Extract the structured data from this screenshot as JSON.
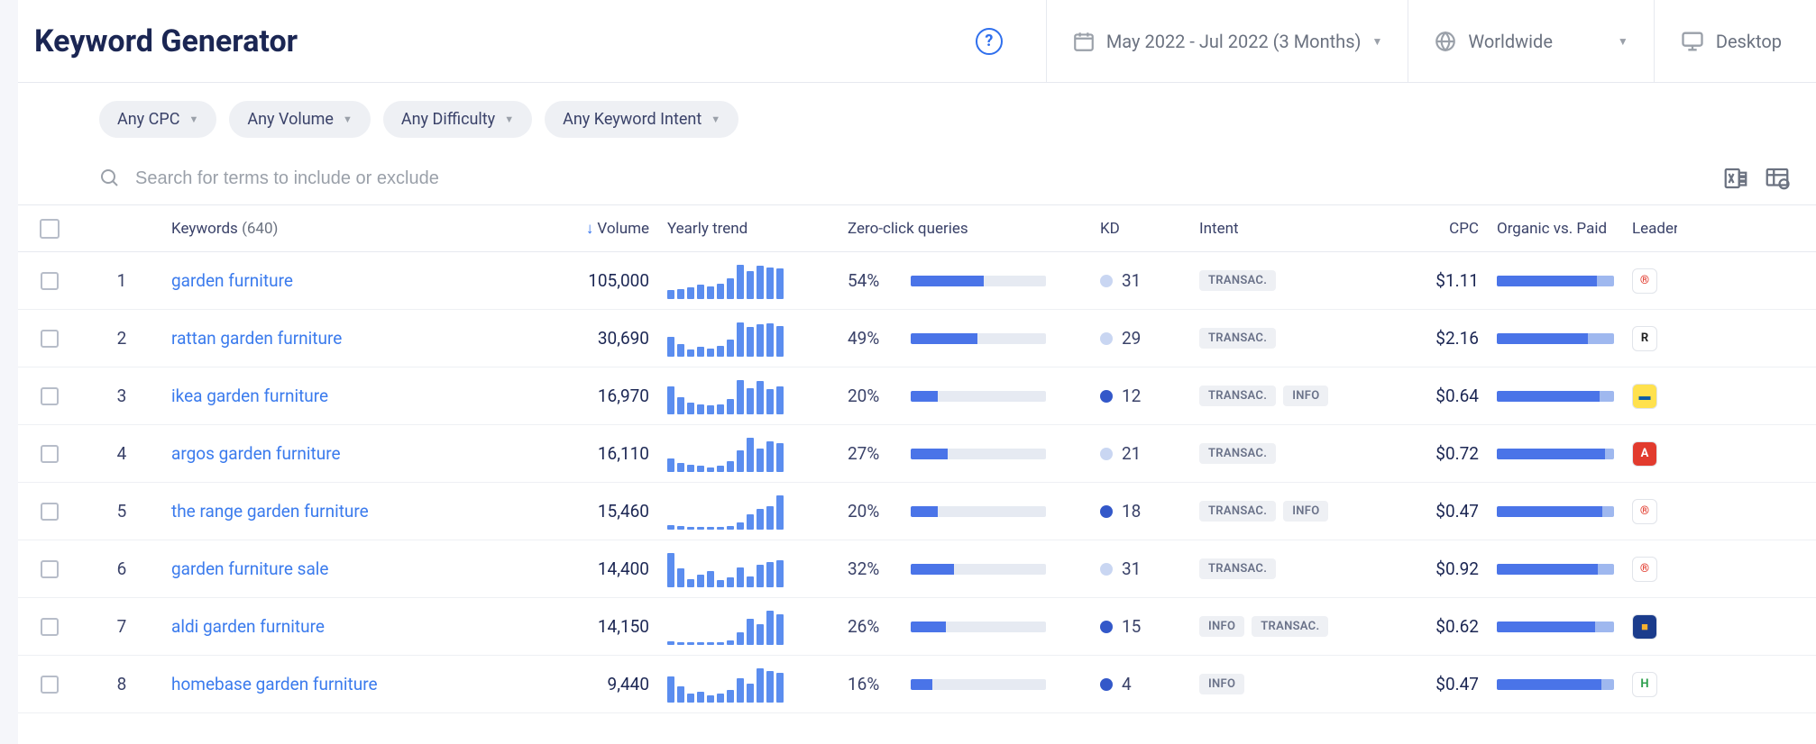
{
  "page_title": "Keyword Generator",
  "date_range": "May 2022 - Jul 2022 (3 Months)",
  "location": "Worldwide",
  "device": "Desktop",
  "filters": {
    "cpc": "Any CPC",
    "volume": "Any Volume",
    "difficulty": "Any Difficulty",
    "intent": "Any Keyword Intent"
  },
  "search_placeholder": "Search for terms to include or exclude",
  "columns": {
    "keywords": "Keywords",
    "keywords_count": "(640)",
    "volume": "Volume",
    "yearly_trend": "Yearly trend",
    "zero_click": "Zero-click queries",
    "kd": "KD",
    "intent": "Intent",
    "cpc": "CPC",
    "organic_vs_paid": "Organic vs. Paid",
    "leader": "Leader"
  },
  "intent_labels": {
    "transac": "TRANSAC.",
    "info": "INFO"
  },
  "kd_colors": {
    "light": "#c9d6f2",
    "med": "#5b8def",
    "dark": "#3358c9"
  },
  "leader_styles": {
    "R_reg": {
      "txt": "®",
      "bg": "#ffffff",
      "fg": "#e23b2e"
    },
    "R_serif": {
      "txt": "R",
      "bg": "#ffffff",
      "fg": "#222"
    },
    "ikea": {
      "txt": "▬",
      "bg": "#ffe14d",
      "fg": "#0a5aa6"
    },
    "argos": {
      "txt": "A",
      "bg": "#e23b2e",
      "fg": "#fff"
    },
    "aldi": {
      "txt": "■",
      "bg": "#1b3c8c",
      "fg": "#f6b12f"
    },
    "homebase": {
      "txt": "H",
      "bg": "#ffffff",
      "fg": "#2fa04f"
    }
  },
  "rows": [
    {
      "idx": "1",
      "keyword": "garden furniture",
      "volume": "105,000",
      "trend": [
        12,
        14,
        16,
        20,
        18,
        22,
        30,
        50,
        40,
        48,
        46,
        44
      ],
      "zcq_pct": "54%",
      "zcq_fill": 54,
      "kd": "31",
      "kd_dot": "light",
      "intents": [
        "transac"
      ],
      "cpc": "$1.11",
      "organic": 85,
      "leader": "R_reg"
    },
    {
      "idx": "2",
      "keyword": "rattan garden furniture",
      "volume": "30,690",
      "trend": [
        30,
        18,
        10,
        14,
        12,
        16,
        26,
        52,
        44,
        48,
        50,
        46
      ],
      "zcq_pct": "49%",
      "zcq_fill": 49,
      "kd": "29",
      "kd_dot": "light",
      "intents": [
        "transac"
      ],
      "cpc": "$2.16",
      "organic": 78,
      "leader": "R_serif"
    },
    {
      "idx": "3",
      "keyword": "ikea garden furniture",
      "volume": "16,970",
      "trend": [
        40,
        24,
        16,
        14,
        12,
        14,
        22,
        50,
        38,
        48,
        36,
        40
      ],
      "zcq_pct": "20%",
      "zcq_fill": 20,
      "kd": "12",
      "kd_dot": "dark",
      "intents": [
        "transac",
        "info"
      ],
      "cpc": "$0.64",
      "organic": 88,
      "leader": "ikea"
    },
    {
      "idx": "4",
      "keyword": "argos garden furniture",
      "volume": "16,110",
      "trend": [
        18,
        12,
        10,
        8,
        6,
        8,
        14,
        30,
        48,
        32,
        42,
        40
      ],
      "zcq_pct": "27%",
      "zcq_fill": 27,
      "kd": "21",
      "kd_dot": "light",
      "intents": [
        "transac"
      ],
      "cpc": "$0.72",
      "organic": 92,
      "leader": "argos"
    },
    {
      "idx": "5",
      "keyword": "the range garden furniture",
      "volume": "15,460",
      "trend": [
        6,
        4,
        3,
        3,
        2,
        3,
        4,
        10,
        22,
        30,
        34,
        50
      ],
      "zcq_pct": "20%",
      "zcq_fill": 20,
      "kd": "18",
      "kd_dot": "dark",
      "intents": [
        "transac",
        "info"
      ],
      "cpc": "$0.47",
      "organic": 90,
      "leader": "R_reg"
    },
    {
      "idx": "6",
      "keyword": "garden furniture sale",
      "volume": "14,400",
      "trend": [
        52,
        28,
        12,
        18,
        24,
        10,
        14,
        30,
        16,
        34,
        38,
        40
      ],
      "zcq_pct": "32%",
      "zcq_fill": 32,
      "kd": "31",
      "kd_dot": "light",
      "intents": [
        "transac"
      ],
      "cpc": "$0.92",
      "organic": 86,
      "leader": "R_reg"
    },
    {
      "idx": "7",
      "keyword": "aldi garden furniture",
      "volume": "14,150",
      "trend": [
        4,
        3,
        2,
        2,
        2,
        3,
        6,
        18,
        38,
        30,
        50,
        44
      ],
      "zcq_pct": "26%",
      "zcq_fill": 26,
      "kd": "15",
      "kd_dot": "dark",
      "intents": [
        "info",
        "transac"
      ],
      "cpc": "$0.62",
      "organic": 84,
      "leader": "aldi"
    },
    {
      "idx": "8",
      "keyword": "homebase garden furniture",
      "volume": "9,440",
      "trend": [
        30,
        18,
        10,
        12,
        8,
        10,
        14,
        28,
        22,
        40,
        36,
        34
      ],
      "zcq_pct": "16%",
      "zcq_fill": 16,
      "kd": "4",
      "kd_dot": "dark",
      "intents": [
        "info"
      ],
      "cpc": "$0.47",
      "organic": 89,
      "leader": "homebase"
    }
  ],
  "chart_data": {
    "type": "bar",
    "note": "12-month relative search-volume sparklines per keyword (values are relative bar heights, 0–52 scale as read from pixel heights; exact underlying monthly volumes not labeled in UI).",
    "months": 12,
    "series": [
      {
        "name": "garden furniture",
        "values": [
          12,
          14,
          16,
          20,
          18,
          22,
          30,
          50,
          40,
          48,
          46,
          44
        ]
      },
      {
        "name": "rattan garden furniture",
        "values": [
          30,
          18,
          10,
          14,
          12,
          16,
          26,
          52,
          44,
          48,
          50,
          46
        ]
      },
      {
        "name": "ikea garden furniture",
        "values": [
          40,
          24,
          16,
          14,
          12,
          14,
          22,
          50,
          38,
          48,
          36,
          40
        ]
      },
      {
        "name": "argos garden furniture",
        "values": [
          18,
          12,
          10,
          8,
          6,
          8,
          14,
          30,
          48,
          32,
          42,
          40
        ]
      },
      {
        "name": "the range garden furniture",
        "values": [
          6,
          4,
          3,
          3,
          2,
          3,
          4,
          10,
          22,
          30,
          34,
          50
        ]
      },
      {
        "name": "garden furniture sale",
        "values": [
          52,
          28,
          12,
          18,
          24,
          10,
          14,
          30,
          16,
          34,
          38,
          40
        ]
      },
      {
        "name": "aldi garden furniture",
        "values": [
          4,
          3,
          2,
          2,
          2,
          3,
          6,
          18,
          38,
          30,
          50,
          44
        ]
      },
      {
        "name": "homebase garden furniture",
        "values": [
          30,
          18,
          10,
          12,
          8,
          10,
          14,
          28,
          22,
          40,
          36,
          34
        ]
      }
    ]
  }
}
